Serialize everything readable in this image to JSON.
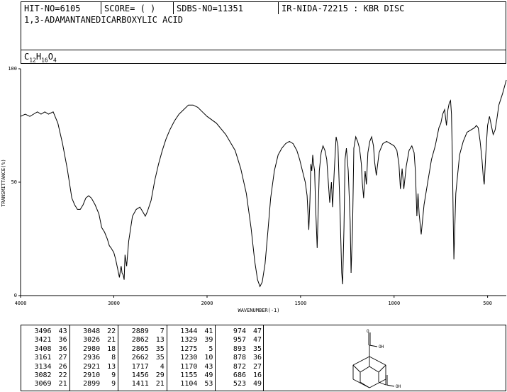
{
  "header": {
    "hit_no": "HIT-NO=6105",
    "score": "SCORE=  (  )",
    "sdbs_no": "SDBS-NO=11351",
    "ir_info": "IR-NIDA-72215 : KBR DISC"
  },
  "compound": {
    "name": "1,3-ADAMANTANEDICARBOXYLIC ACID",
    "formula_parts": [
      "C",
      "12",
      "H",
      "16",
      "O",
      "4"
    ]
  },
  "chart_data": {
    "type": "line",
    "title": "",
    "xlabel": "WAVENUMBER(-1)",
    "ylabel": "TRANSMITTANCE(%)",
    "xlim": [
      4000,
      400
    ],
    "ylim": [
      0,
      100
    ],
    "x_ticks": [
      4000,
      3000,
      2000,
      1500,
      1000,
      500
    ],
    "y_ticks": [
      0,
      50,
      100
    ],
    "grid": false,
    "series": [
      {
        "x": [
          4000,
          3950,
          3900,
          3860,
          3820,
          3780,
          3740,
          3700,
          3650,
          3600,
          3550,
          3500,
          3450,
          3420,
          3390,
          3360,
          3330,
          3300,
          3270,
          3240,
          3200,
          3160,
          3130,
          3100,
          3070,
          3048,
          3030,
          3000,
          2980,
          2960,
          2940,
          2930,
          2921,
          2912,
          2899,
          2889,
          2880,
          2862,
          2840,
          2800,
          2760,
          2720,
          2690,
          2662,
          2640,
          2600,
          2560,
          2520,
          2480,
          2440,
          2400,
          2350,
          2300,
          2250,
          2200,
          2150,
          2100,
          2050,
          2000,
          1950,
          1900,
          1850,
          1820,
          1790,
          1765,
          1745,
          1730,
          1717,
          1705,
          1690,
          1675,
          1660,
          1640,
          1620,
          1600,
          1580,
          1560,
          1540,
          1520,
          1505,
          1490,
          1475,
          1465,
          1456,
          1450,
          1445,
          1440,
          1435,
          1430,
          1425,
          1420,
          1411,
          1400,
          1390,
          1380,
          1370,
          1360,
          1344,
          1335,
          1329,
          1320,
          1310,
          1300,
          1290,
          1280,
          1275,
          1268,
          1262,
          1255,
          1245,
          1235,
          1230,
          1222,
          1215,
          1205,
          1195,
          1185,
          1175,
          1170,
          1163,
          1155,
          1148,
          1140,
          1130,
          1120,
          1110,
          1104,
          1095,
          1080,
          1060,
          1040,
          1020,
          1000,
          985,
          974,
          966,
          957,
          948,
          935,
          920,
          905,
          893,
          886,
          878,
          872,
          866,
          855,
          840,
          820,
          800,
          780,
          770,
          760,
          750,
          740,
          730,
          720,
          712,
          705,
          698,
          693,
          688,
          684,
          680,
          670,
          650,
          630,
          610,
          590,
          570,
          560,
          550,
          540,
          530,
          523,
          518,
          510,
          500,
          490,
          480,
          470,
          460,
          450,
          440,
          420,
          400
        ],
        "y": [
          79,
          80,
          79,
          80,
          81,
          80,
          81,
          80,
          81,
          76,
          67,
          56,
          43,
          40,
          38,
          38,
          40,
          43,
          44,
          43,
          40,
          36,
          30,
          28,
          25,
          22,
          21,
          19,
          16,
          12,
          8,
          11,
          13,
          10,
          9,
          7,
          18,
          13,
          24,
          35,
          38,
          39,
          37,
          35,
          37,
          42,
          51,
          58,
          64,
          69,
          73,
          77,
          80,
          82,
          84,
          84,
          83,
          81,
          79,
          76,
          71,
          64,
          56,
          45,
          30,
          15,
          7,
          4,
          6,
          14,
          28,
          43,
          55,
          62,
          65,
          67,
          68,
          67,
          64,
          60,
          55,
          50,
          44,
          29,
          42,
          58,
          55,
          62,
          58,
          55,
          40,
          21,
          55,
          63,
          66,
          64,
          60,
          41,
          50,
          39,
          55,
          70,
          66,
          40,
          10,
          5,
          30,
          60,
          65,
          55,
          33,
          10,
          30,
          65,
          70,
          68,
          65,
          58,
          50,
          43,
          55,
          49,
          63,
          68,
          70,
          66,
          59,
          53,
          63,
          67,
          68,
          67,
          66,
          64,
          58,
          47,
          56,
          47,
          57,
          64,
          66,
          63,
          55,
          35,
          45,
          36,
          27,
          40,
          50,
          60,
          66,
          70,
          74,
          76,
          80,
          82,
          75,
          82,
          85,
          86,
          80,
          60,
          35,
          16,
          45,
          62,
          68,
          72,
          73,
          74,
          75,
          74,
          68,
          60,
          52,
          49,
          62,
          75,
          79,
          75,
          71,
          73,
          78,
          84,
          89,
          95
        ]
      }
    ]
  },
  "peaks": [
    [
      [
        "3496",
        "43"
      ],
      [
        "3421",
        "36"
      ],
      [
        "3408",
        "36"
      ],
      [
        "3161",
        "27"
      ],
      [
        "3134",
        "26"
      ],
      [
        "3082",
        "22"
      ],
      [
        "3069",
        "21"
      ]
    ],
    [
      [
        "3048",
        "22"
      ],
      [
        "3026",
        "21"
      ],
      [
        "2980",
        "18"
      ],
      [
        "2936",
        "8"
      ],
      [
        "2921",
        "13"
      ],
      [
        "2910",
        "9"
      ],
      [
        "2899",
        "9"
      ]
    ],
    [
      [
        "2889",
        "7"
      ],
      [
        "2862",
        "13"
      ],
      [
        "2865",
        "35"
      ],
      [
        "2662",
        "35"
      ],
      [
        "1717",
        "4"
      ],
      [
        "1456",
        "29"
      ],
      [
        "1411",
        "21"
      ]
    ],
    [
      [
        "1344",
        "41"
      ],
      [
        "1329",
        "39"
      ],
      [
        "1275",
        "5"
      ],
      [
        "1230",
        "10"
      ],
      [
        "1170",
        "43"
      ],
      [
        "1155",
        "49"
      ],
      [
        "1104",
        "53"
      ]
    ],
    [
      [
        "974",
        "47"
      ],
      [
        "957",
        "47"
      ],
      [
        "893",
        "35"
      ],
      [
        "878",
        "36"
      ],
      [
        "872",
        "27"
      ],
      [
        "686",
        "16"
      ],
      [
        "523",
        "49"
      ]
    ]
  ],
  "structure_labels": {
    "carbonyl_o": "O",
    "hydroxyl_top": "OH",
    "hydroxyl_bottom": "OH"
  }
}
